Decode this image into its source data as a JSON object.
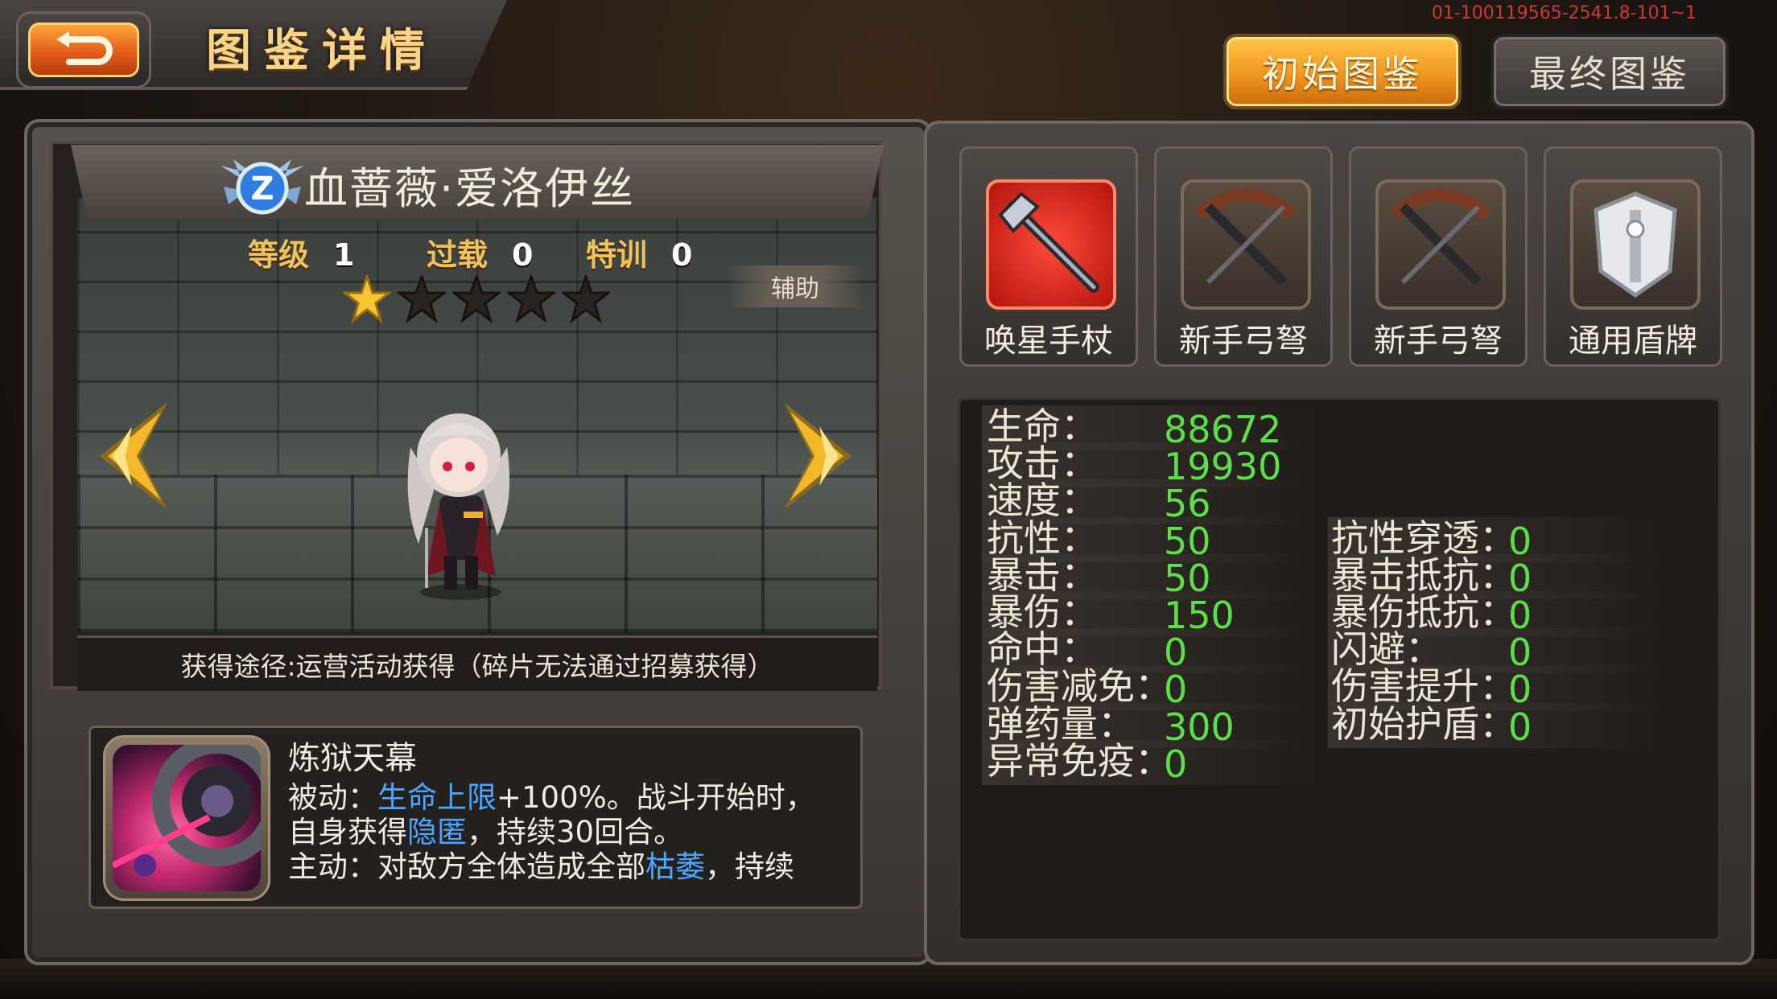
{
  "header": {
    "title": "图鉴详情",
    "version": "01-100119565-2541.8-101~1",
    "btn_initial": "初始图鉴",
    "btn_final": "最终图鉴"
  },
  "hero": {
    "name": "血蔷薇·爱洛伊丝",
    "rank_letter": "Z",
    "level_label": "等级",
    "level_value": "1",
    "overload_label": "过载",
    "overload_value": "0",
    "training_label": "特训",
    "training_value": "0",
    "stars_filled": 1,
    "stars_total": 5,
    "role": "辅助",
    "acquire": "获得途径:运营活动获得（碎片无法通过招募获得）"
  },
  "skill": {
    "name": "炼狱天幕",
    "line1_a": "被动：",
    "line1_hl": "生命上限",
    "line1_b": "+100%。战斗开始时，",
    "line2_a": "自身获得",
    "line2_hl": "隐匿",
    "line2_b": "，持续30回合。",
    "line3_a": "主动：对敌方全体造成全部",
    "line3_hl": "枯萎",
    "line3_b": "，持续"
  },
  "equipment": [
    {
      "label": "唤星手杖",
      "icon": "staff-icon"
    },
    {
      "label": "新手弓弩",
      "icon": "crossbow-icon"
    },
    {
      "label": "新手弓弩",
      "icon": "crossbow-icon"
    },
    {
      "label": "通用盾牌",
      "icon": "shield-icon"
    }
  ],
  "stats_left": [
    {
      "label": "生命：",
      "value": "88672"
    },
    {
      "label": "攻击：",
      "value": "19930"
    },
    {
      "label": "速度：",
      "value": "56"
    },
    {
      "label": "抗性：",
      "value": "50"
    },
    {
      "label": "暴击：",
      "value": "50"
    },
    {
      "label": "暴伤：",
      "value": "150"
    },
    {
      "label": "命中：",
      "value": "0"
    },
    {
      "label": "伤害减免：",
      "value": "0"
    },
    {
      "label": "弹药量：",
      "value": "300"
    },
    {
      "label": "异常免疫：",
      "value": "0"
    }
  ],
  "stats_right": [
    {
      "label": "抗性穿透：",
      "value": "0"
    },
    {
      "label": "暴击抵抗：",
      "value": "0"
    },
    {
      "label": "暴伤抵抗：",
      "value": "0"
    },
    {
      "label": "闪避：",
      "value": "0"
    },
    {
      "label": "伤害提升：",
      "value": "0"
    },
    {
      "label": "初始护盾：",
      "value": "0"
    }
  ],
  "colors": {
    "stat_value": "#5be04a",
    "highlight": "#4aa6ff",
    "accent": "#f0961e"
  }
}
